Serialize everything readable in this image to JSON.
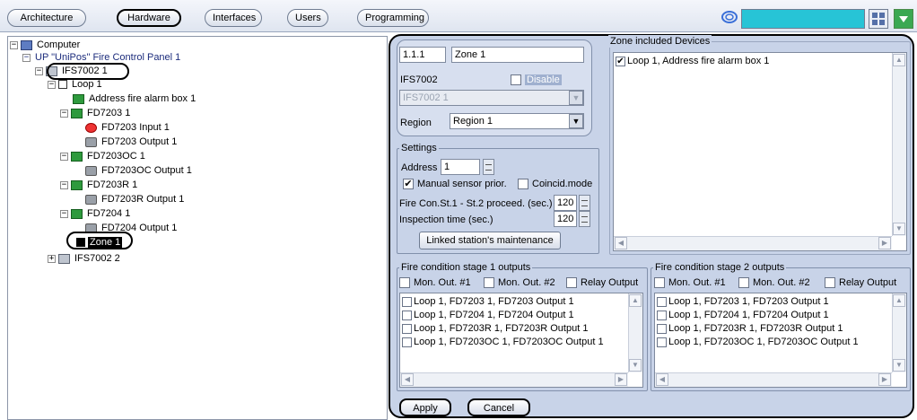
{
  "tabs": [
    {
      "label": "Architecture",
      "active": false
    },
    {
      "label": "Hardware",
      "active": true
    },
    {
      "label": "Interfaces",
      "active": false
    },
    {
      "label": "Users",
      "active": false
    },
    {
      "label": "Programming",
      "active": false
    }
  ],
  "tree": [
    {
      "label": "Computer",
      "icon": "computer-icon",
      "expander": "−"
    },
    {
      "label": "UP \"UniPos\" Fire Control Panel 1",
      "icon": "",
      "expander": "−"
    },
    {
      "label": "IFS7002 1",
      "icon": "panel-icon",
      "expander": "−"
    },
    {
      "label": "Loop 1",
      "icon": "loop-icon",
      "expander": "−"
    },
    {
      "label": "Address fire alarm box 1",
      "icon": "alarm-box-icon",
      "expander": ""
    },
    {
      "label": "FD7203 1",
      "icon": "alarm-box-icon",
      "expander": "−"
    },
    {
      "label": "FD7203 Input 1",
      "icon": "input-icon",
      "expander": ""
    },
    {
      "label": "FD7203 Output 1",
      "icon": "output-icon",
      "expander": ""
    },
    {
      "label": "FD7203OC 1",
      "icon": "alarm-box-icon",
      "expander": "−"
    },
    {
      "label": "FD7203OC Output 1",
      "icon": "output-icon",
      "expander": ""
    },
    {
      "label": "FD7203R 1",
      "icon": "alarm-box-icon",
      "expander": "−"
    },
    {
      "label": "FD7203R Output 1",
      "icon": "output-icon",
      "expander": ""
    },
    {
      "label": "FD7204 1",
      "icon": "alarm-box-icon",
      "expander": "−"
    },
    {
      "label": "FD7204 Output 1",
      "icon": "output-icon",
      "expander": ""
    },
    {
      "label": "Zone 1",
      "icon": "zone-icon",
      "expander": "",
      "selected": true
    },
    {
      "label": "IFS7002 2",
      "icon": "panel-icon",
      "expander": "+"
    }
  ],
  "zone": {
    "number": "1.1.1",
    "name": "Zone 1",
    "device_label": "IFS7002",
    "disable_label": "Disable",
    "device_value": "IFS7002 1",
    "region_label": "Region",
    "region_value": "Region 1"
  },
  "settings": {
    "title": "Settings",
    "address_label": "Address",
    "address_value": "1",
    "manual_sensor_label": "Manual sensor prior.",
    "manual_sensor_checked": true,
    "coincid_label": "Coincid.mode",
    "coincid_checked": false,
    "fire_con_label": "Fire Con.St.1 - St.2 proceed. (sec.)",
    "fire_con_value": "120",
    "inspection_label": "Inspection time (sec.)",
    "inspection_value": "120",
    "linked_button": "Linked station's maintenance"
  },
  "included": {
    "title": "Zone included Devices",
    "items": [
      {
        "label": "Loop 1, Address fire alarm box 1",
        "checked": true
      }
    ]
  },
  "stage1": {
    "title": "Fire condition stage 1 outputs",
    "mon1": "Mon. Out. #1",
    "mon2": "Mon. Out. #2",
    "relay": "Relay Output",
    "items": [
      {
        "label": "Loop 1, FD7203 1, FD7203 Output 1",
        "checked": false
      },
      {
        "label": "Loop 1, FD7204 1, FD7204 Output 1",
        "checked": false
      },
      {
        "label": "Loop 1, FD7203R 1, FD7203R Output 1",
        "checked": false
      },
      {
        "label": "Loop 1, FD7203OC 1, FD7203OC Output 1",
        "checked": false
      }
    ]
  },
  "stage2": {
    "title": "Fire condition stage 2 outputs",
    "mon1": "Mon. Out. #1",
    "mon2": "Mon. Out. #2",
    "relay": "Relay Output",
    "items": [
      {
        "label": "Loop 1, FD7203 1, FD7203 Output 1",
        "checked": false
      },
      {
        "label": "Loop 1, FD7204 1, FD7204 Output 1",
        "checked": false
      },
      {
        "label": "Loop 1, FD7203R 1, FD7203R Output 1",
        "checked": false
      },
      {
        "label": "Loop 1, FD7203OC 1, FD7203OC Output 1",
        "checked": false
      }
    ]
  },
  "actions": {
    "apply": "Apply",
    "cancel": "Cancel"
  },
  "colors": {
    "panel_bg": "#c8d3e8",
    "status_field": "#27c4d6",
    "accent_green": "#3aa852"
  }
}
